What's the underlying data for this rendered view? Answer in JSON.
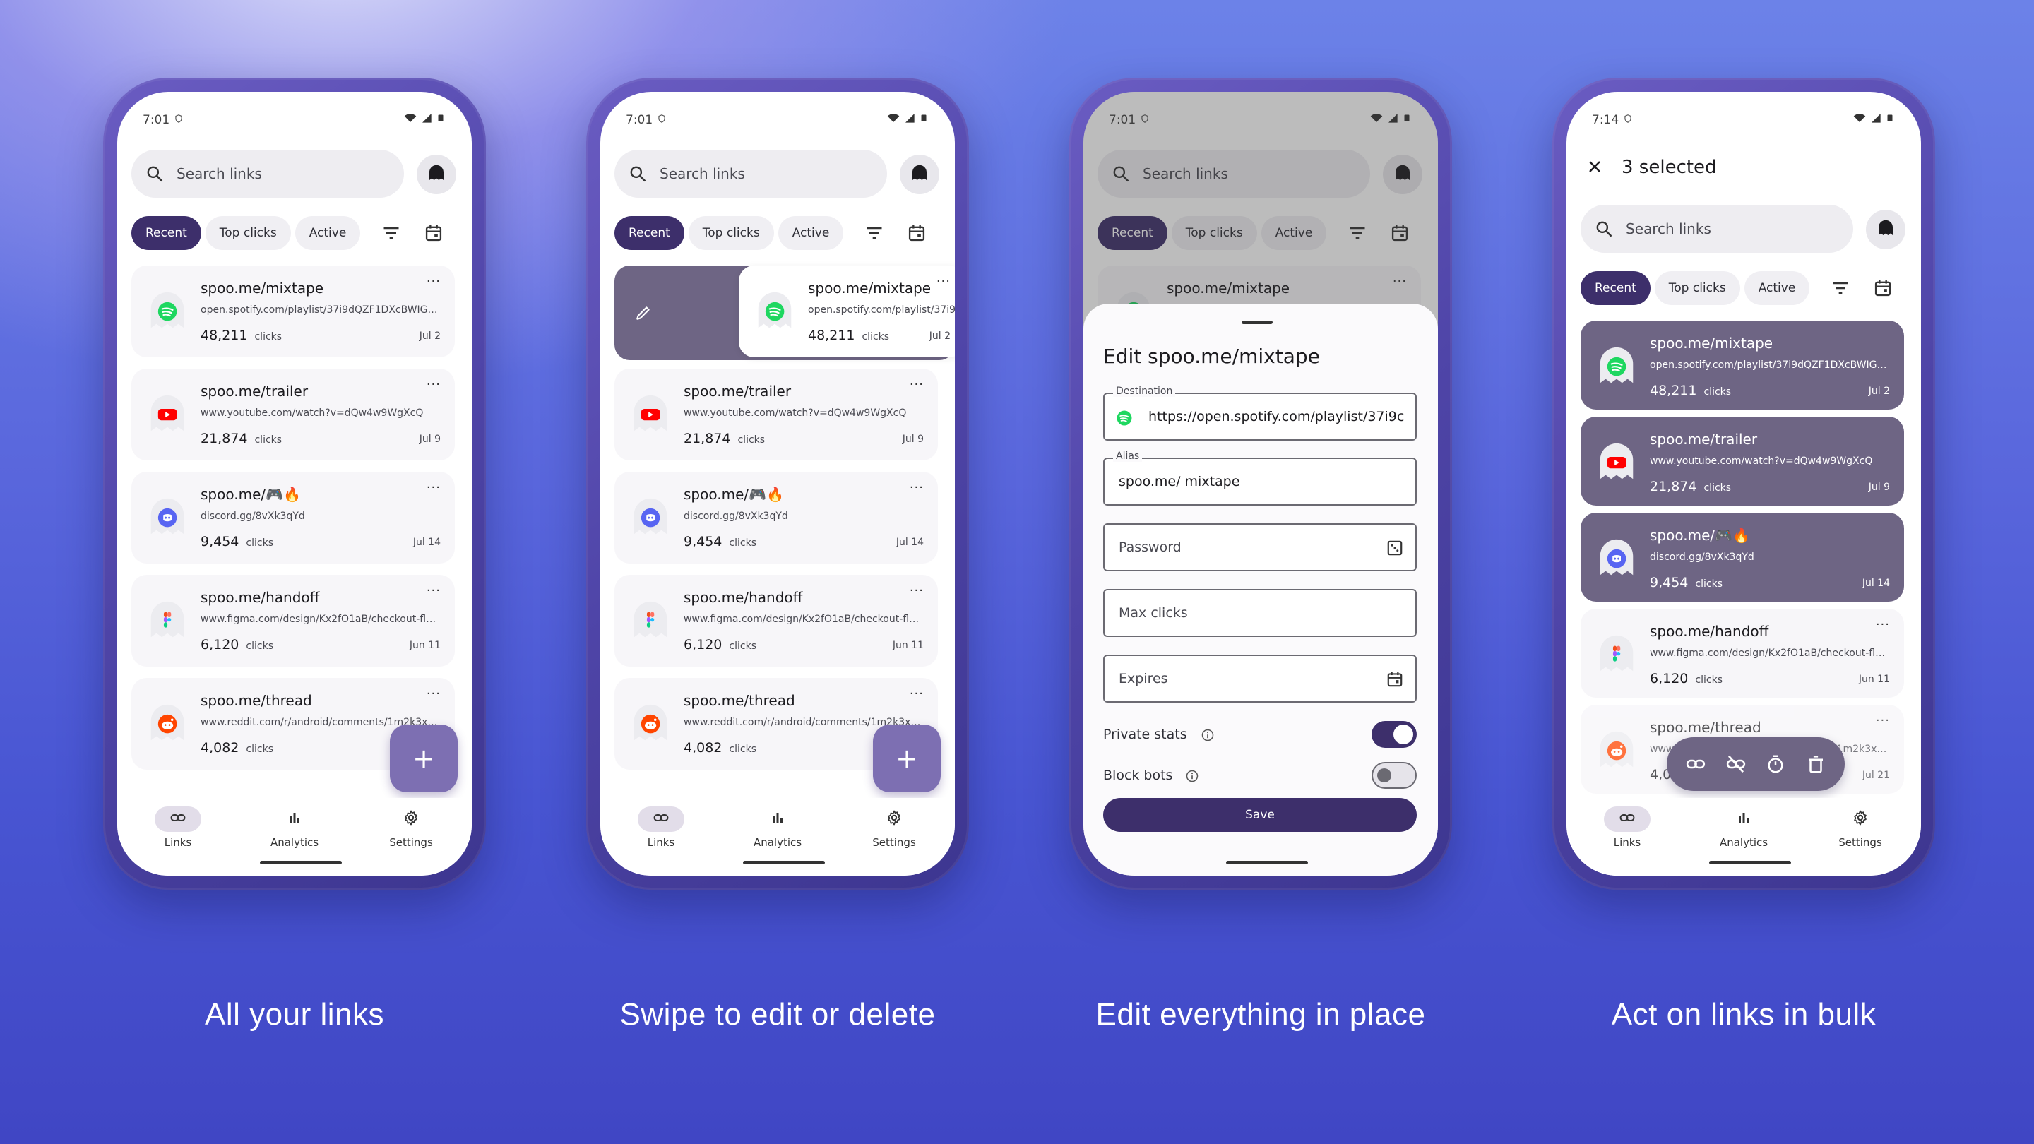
{
  "captions": [
    "All your links",
    "Swipe to edit or delete",
    "Edit everything in place",
    "Act on links in bulk"
  ],
  "status_times": [
    "7:01",
    "7:01",
    "7:01",
    "7:14"
  ],
  "search": {
    "placeholder": "Search links"
  },
  "chips": [
    "Recent",
    "Top clicks",
    "Active"
  ],
  "links": [
    {
      "alias": "spoo.me/mixtape",
      "url": "open.spotify.com/playlist/37i9dQZF1DXcBWIGoY...",
      "clicks": "48,211",
      "clicks_label": "clicks",
      "date": "Jul 2",
      "icon": "spotify-icon",
      "color": "#1ed760"
    },
    {
      "alias": "spoo.me/trailer",
      "url": "www.youtube.com/watch?v=dQw4w9WgXcQ",
      "clicks": "21,874",
      "clicks_label": "clicks",
      "date": "Jul 9",
      "icon": "youtube-icon",
      "color": "#ff0000"
    },
    {
      "alias": "spoo.me/🎮🔥",
      "url": "discord.gg/8vXk3qYd",
      "clicks": "9,454",
      "clicks_label": "clicks",
      "date": "Jul 14",
      "icon": "discord-icon",
      "color": "#5865f2"
    },
    {
      "alias": "spoo.me/handoff",
      "url": "www.figma.com/design/Kx2fO1aB/checkout-flow...",
      "clicks": "6,120",
      "clicks_label": "clicks",
      "date": "Jun 11",
      "icon": "figma-icon",
      "color": "#f24e1e"
    },
    {
      "alias": "spoo.me/thread",
      "url": "www.reddit.com/r/android/comments/1m2k3x/pi...",
      "clicks": "4,082",
      "clicks_label": "clicks",
      "date": "Jul 21",
      "icon": "reddit-icon",
      "color": "#ff4500"
    }
  ],
  "more_label": "···",
  "fab_label": "+",
  "nav": [
    {
      "label": "Links",
      "icon": "link-icon"
    },
    {
      "label": "Analytics",
      "icon": "bar-chart-icon"
    },
    {
      "label": "Settings",
      "icon": "gear-icon"
    }
  ],
  "edit": {
    "title": "Edit spoo.me/mixtape",
    "destination_label": "Destination",
    "destination_value": "https://open.spotify.com/playlist/37i9c",
    "alias_label": "Alias",
    "alias_value": "spoo.me/ mixtape",
    "password_placeholder": "Password",
    "max_clicks_placeholder": "Max clicks",
    "expires_placeholder": "Expires",
    "private_stats_label": "Private stats",
    "private_stats_on": true,
    "block_bots_label": "Block bots",
    "block_bots_on": false,
    "save_label": "Save"
  },
  "bulk": {
    "selected_label": "3 selected"
  },
  "colors": {
    "accent": "#3d2f6b",
    "selected_card": "#6e6584",
    "fab": "#7d6fb2"
  }
}
